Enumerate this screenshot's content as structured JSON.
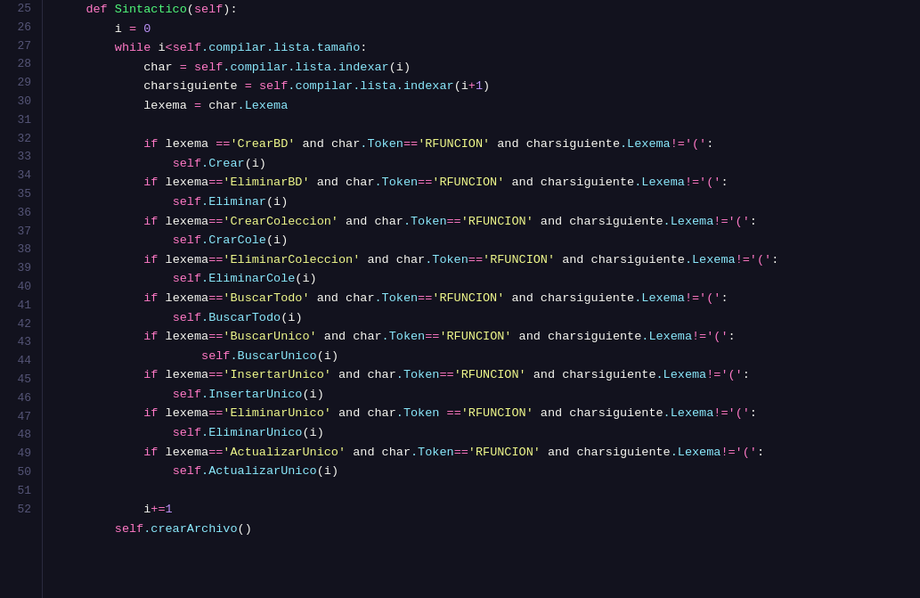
{
  "editor": {
    "background": "#12121e",
    "lines": [
      {
        "num": 25,
        "active": false
      },
      {
        "num": 26,
        "active": false
      },
      {
        "num": 27,
        "active": false
      },
      {
        "num": 28,
        "active": false
      },
      {
        "num": 29,
        "active": false
      },
      {
        "num": 30,
        "active": false
      },
      {
        "num": 31,
        "active": false
      },
      {
        "num": 32,
        "active": false
      },
      {
        "num": 33,
        "active": false
      },
      {
        "num": 34,
        "active": false
      },
      {
        "num": 35,
        "active": false
      },
      {
        "num": 36,
        "active": false
      },
      {
        "num": 37,
        "active": false
      },
      {
        "num": 38,
        "active": false
      },
      {
        "num": 39,
        "active": false
      },
      {
        "num": 40,
        "active": false
      },
      {
        "num": 41,
        "active": false
      },
      {
        "num": 42,
        "active": false
      },
      {
        "num": 43,
        "active": false
      },
      {
        "num": 44,
        "active": false
      },
      {
        "num": 45,
        "active": false
      },
      {
        "num": 46,
        "active": false
      },
      {
        "num": 47,
        "active": false
      },
      {
        "num": 48,
        "active": false
      },
      {
        "num": 49,
        "active": false
      },
      {
        "num": 50,
        "active": false
      },
      {
        "num": 51,
        "active": false
      },
      {
        "num": 52,
        "active": false
      }
    ]
  }
}
